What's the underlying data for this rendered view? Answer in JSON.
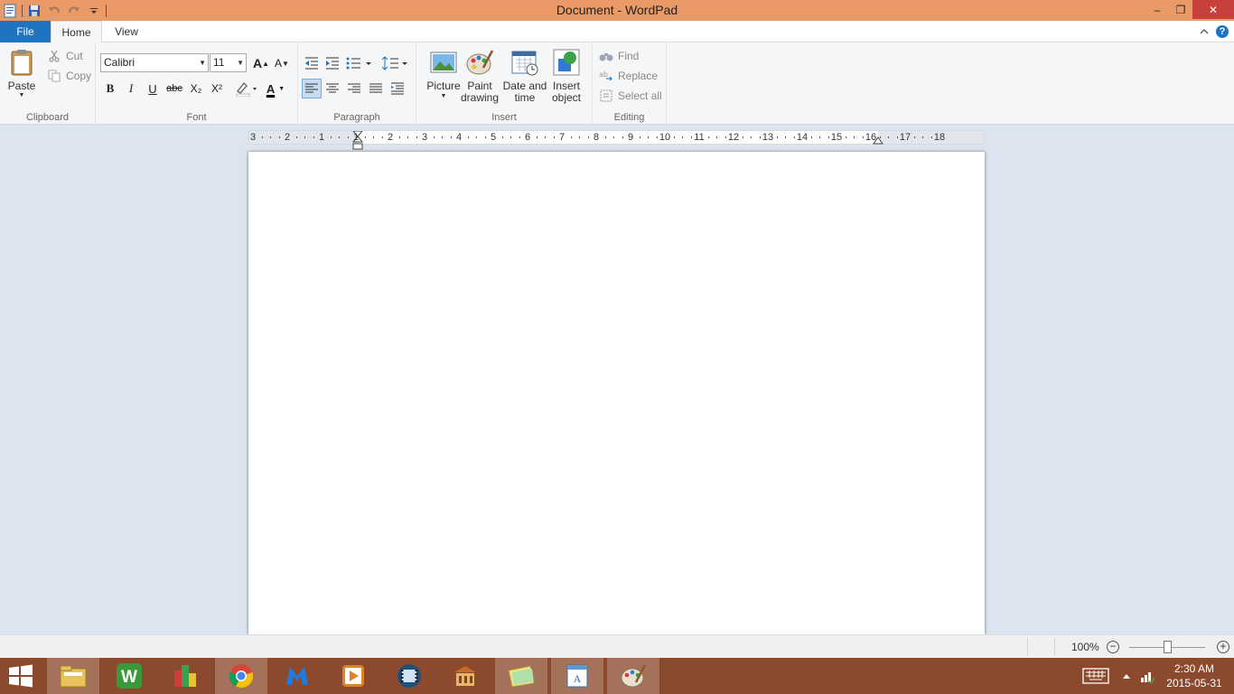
{
  "window": {
    "title": "Document - WordPad",
    "minimize": "–",
    "restore": "❐",
    "close": "✕"
  },
  "tabs": {
    "file": "File",
    "home": "Home",
    "view": "View",
    "help": "?"
  },
  "ribbon": {
    "clipboard": {
      "label": "Clipboard",
      "paste": "Paste",
      "cut": "Cut",
      "copy": "Copy"
    },
    "font": {
      "label": "Font",
      "family": "Calibri",
      "size": "11",
      "bold": "B",
      "italic": "I",
      "underline": "U",
      "strikethrough": "abc",
      "subscript": "X₂",
      "superscript": "X²",
      "grow": "A",
      "shrink": "A",
      "color": "A"
    },
    "paragraph": {
      "label": "Paragraph"
    },
    "insert": {
      "label": "Insert",
      "picture": "Picture",
      "paint_drawing_1": "Paint",
      "paint_drawing_2": "drawing",
      "date_time_1": "Date and",
      "date_time_2": "time",
      "insert_object_1": "Insert",
      "insert_object_2": "object"
    },
    "editing": {
      "label": "Editing",
      "find": "Find",
      "replace": "Replace",
      "select_all": "Select all"
    }
  },
  "ruler": {
    "labels": [
      "3",
      "2",
      "1",
      "1",
      "2",
      "3",
      "4",
      "5",
      "6",
      "7",
      "8",
      "9",
      "10",
      "11",
      "12",
      "13",
      "14",
      "15",
      "16",
      "17",
      "18"
    ]
  },
  "status": {
    "zoom": "100%",
    "zoom_out": "−",
    "zoom_in": "+",
    "zoom_level": 0.5
  },
  "taskbar": {
    "time": "2:30 AM",
    "date": "2015-05-31"
  },
  "colors": {
    "titlebar": "#e99a66",
    "file_tab": "#1e73c3",
    "taskbar": "#8b4a2e",
    "close_button": "#c7403a"
  }
}
